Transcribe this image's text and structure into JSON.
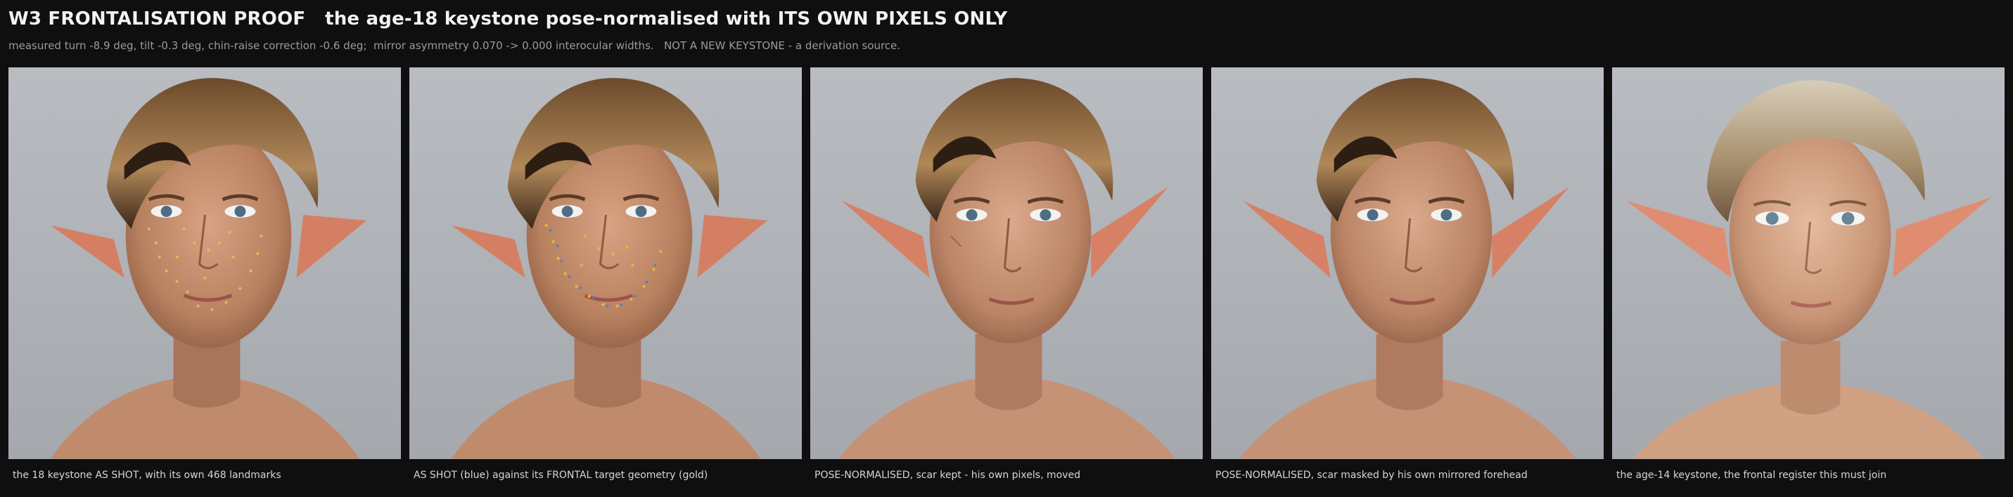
{
  "header": {
    "title": "W3 FRONTALISATION PROOF   the age-18 keystone pose-normalised with ITS OWN PIXELS ONLY",
    "subtitle": "measured turn -8.9 deg, tilt -0.3 deg, chin-raise correction -0.6 deg;  mirror asymmetry 0.070 -> 0.000 interocular widths.   NOT A NEW KEYSTONE - a derivation source."
  },
  "colors": {
    "background": "#0f0f0f",
    "landmark_gold": "#e0b640",
    "landmark_blue": "#4a7fd6"
  },
  "panels": [
    {
      "caption": "the 18 keystone AS SHOT, with its own 468 landmarks",
      "icon": "face-with-landmarks"
    },
    {
      "caption": "AS SHOT (blue) against its FRONTAL target geometry (gold)",
      "icon": "face-with-target-overlay"
    },
    {
      "caption": "POSE-NORMALISED, scar kept - his own pixels, moved",
      "icon": "face-frontal"
    },
    {
      "caption": "POSE-NORMALISED, scar masked by his own mirrored forehead",
      "icon": "face-frontal-masked"
    },
    {
      "caption": "the age-14 keystone, the frontal register this must join",
      "icon": "face-age14"
    }
  ]
}
